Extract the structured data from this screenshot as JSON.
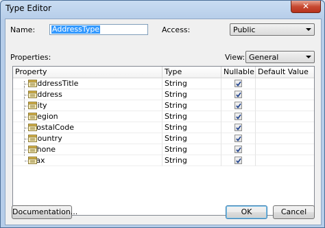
{
  "window": {
    "title": "Type Editor",
    "close_glyph": "✕"
  },
  "form": {
    "name_label": "Name:",
    "name_value": "AddressType",
    "access_label": "Access:",
    "access_value": "Public",
    "properties_label": "Properties:",
    "view_label": "View:",
    "view_value": "General"
  },
  "grid": {
    "columns": [
      "Property",
      "Type",
      "Nullable",
      "Default Value"
    ],
    "rows": [
      {
        "property": "AddressTitle",
        "type": "String",
        "nullable": true,
        "default": ""
      },
      {
        "property": "Address",
        "type": "String",
        "nullable": true,
        "default": ""
      },
      {
        "property": "City",
        "type": "String",
        "nullable": true,
        "default": ""
      },
      {
        "property": "Region",
        "type": "String",
        "nullable": true,
        "default": ""
      },
      {
        "property": "PostalCode",
        "type": "String",
        "nullable": true,
        "default": ""
      },
      {
        "property": "Country",
        "type": "String",
        "nullable": true,
        "default": ""
      },
      {
        "property": "Phone",
        "type": "String",
        "nullable": true,
        "default": ""
      },
      {
        "property": "Fax",
        "type": "String",
        "nullable": true,
        "default": ""
      }
    ]
  },
  "buttons": {
    "documentation": "Documentation...",
    "ok": "OK",
    "cancel": "Cancel"
  },
  "colors": {
    "titlebar": "#c9dcf2",
    "selection": "#3399ff",
    "close": "#c74a32"
  }
}
